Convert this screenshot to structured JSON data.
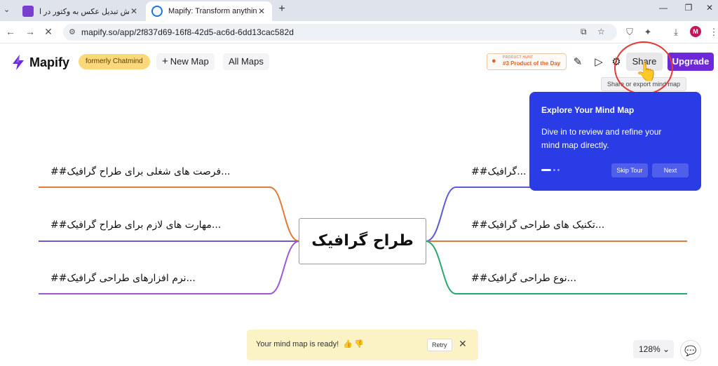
{
  "browser": {
    "tabs": [
      {
        "title": "آموزش تبدیل عکس به وکتور در ا...",
        "active": false
      },
      {
        "title": "Mapify: Transform anything to ...",
        "active": true
      }
    ],
    "url": "mapify.so/app/2f837d69-16f8-42d5-ac6d-6dd13cac582d",
    "profile_initial": "M"
  },
  "header": {
    "logo_text": "Mapify",
    "formerly_badge": "formerly Chatmind",
    "new_map_label": "New Map",
    "all_maps_label": "All Maps",
    "award_small": "PRODUCT HUNT",
    "award_big": "#3 Product of the Day",
    "share_label": "Share",
    "upgrade_label": "Upgrade",
    "share_tooltip": "Share or export mind map"
  },
  "mindmap": {
    "root": "طراح گرافیک",
    "left_nodes": [
      {
        "text": "##فرصت های شغلی برای طراح گرافیک...",
        "color": "#e07b39"
      },
      {
        "text": "##مهارت های لازم برای طراح گرافیک...",
        "color": "#6b5bd6"
      },
      {
        "text": "##نرم افزارهای طراحی گرافیک...",
        "color": "#9b59d6"
      }
    ],
    "right_nodes": [
      {
        "text": "##گرافیک...",
        "color": "#5b5bd6"
      },
      {
        "text": "##تکنیک های طراحی گرافیک...",
        "color": "#e07b39"
      },
      {
        "text": "##نوع طراحی گرافیک...",
        "color": "#27a86a"
      }
    ]
  },
  "tour": {
    "title": "Explore Your Mind Map",
    "body": "Dive in to review and refine your mind map directly.",
    "skip_label": "Skip Tour",
    "next_label": "Next"
  },
  "toast": {
    "message": "Your mind map is ready!",
    "retry_label": "Retry"
  },
  "zoom_level": "128%",
  "colors": {
    "accent": "#6d28d9",
    "tour_bg": "#2a3ce6",
    "toast_bg": "#fbf3c5"
  }
}
